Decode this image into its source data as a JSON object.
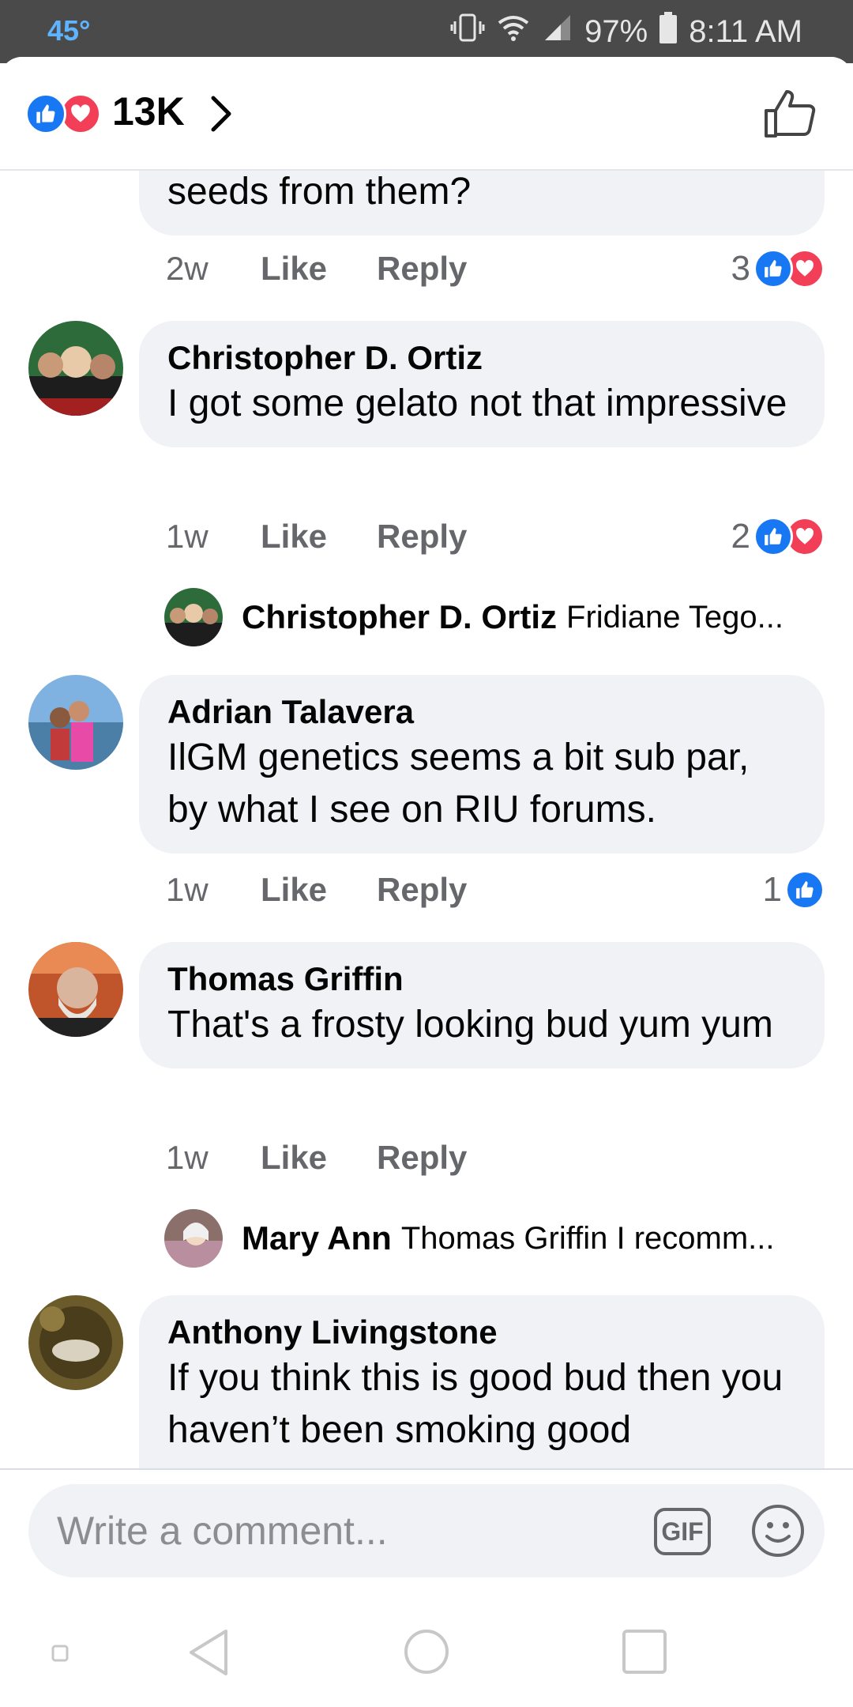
{
  "status_bar": {
    "temperature": "45°",
    "battery": "97%",
    "time": "8:11 AM"
  },
  "header": {
    "reaction_count": "13K",
    "reactions": [
      "like",
      "love"
    ]
  },
  "comments": [
    {
      "id": "c0",
      "author": "",
      "text": "seeds from them?",
      "time_ago": "2w",
      "like_label": "Like",
      "reply_label": "Reply",
      "reaction_count": "3",
      "reactions": [
        "like",
        "love"
      ]
    },
    {
      "id": "c1",
      "author": "Christopher D. Ortiz",
      "text": "I got some gelato not that impressive",
      "time_ago": "1w",
      "like_label": "Like",
      "reply_label": "Reply",
      "reaction_count": "2",
      "reactions": [
        "like",
        "love"
      ],
      "reply_preview": {
        "author": "Christopher D. Ortiz",
        "text": "Fridiane Tego..."
      }
    },
    {
      "id": "c2",
      "author": "Adrian Talavera",
      "text": "IlGM genetics seems a bit sub par, by what I see on RIU forums.",
      "time_ago": "1w",
      "like_label": "Like",
      "reply_label": "Reply",
      "reaction_count": "1",
      "reactions": [
        "like"
      ]
    },
    {
      "id": "c3",
      "author": "Thomas Griffin",
      "text": "That's a frosty looking bud yum yum",
      "time_ago": "1w",
      "like_label": "Like",
      "reply_label": "Reply",
      "reaction_count": "",
      "reactions": [],
      "reply_preview": {
        "author": "Mary Ann",
        "text": "Thomas Griffin I recomm..."
      }
    },
    {
      "id": "c4",
      "author": "Anthony Livingstone",
      "text": "If you think this is good bud then you haven’t been smoking good",
      "time_ago": "",
      "like_label": "",
      "reply_label": "",
      "reaction_count": "",
      "reactions": []
    }
  ],
  "composer": {
    "placeholder": "Write a comment...",
    "gif_label": "GIF"
  },
  "colors": {
    "like_blue": "#1877f2",
    "love_red": "#f33e58",
    "bubble_bg": "#f0f2f5",
    "meta_gray": "#65676b"
  },
  "icons": [
    "like-reaction-icon",
    "love-reaction-icon",
    "chevron-right-icon",
    "thumbs-up-icon",
    "gif-icon",
    "emoji-icon",
    "back-icon",
    "home-icon",
    "recents-icon",
    "dot-icon"
  ]
}
